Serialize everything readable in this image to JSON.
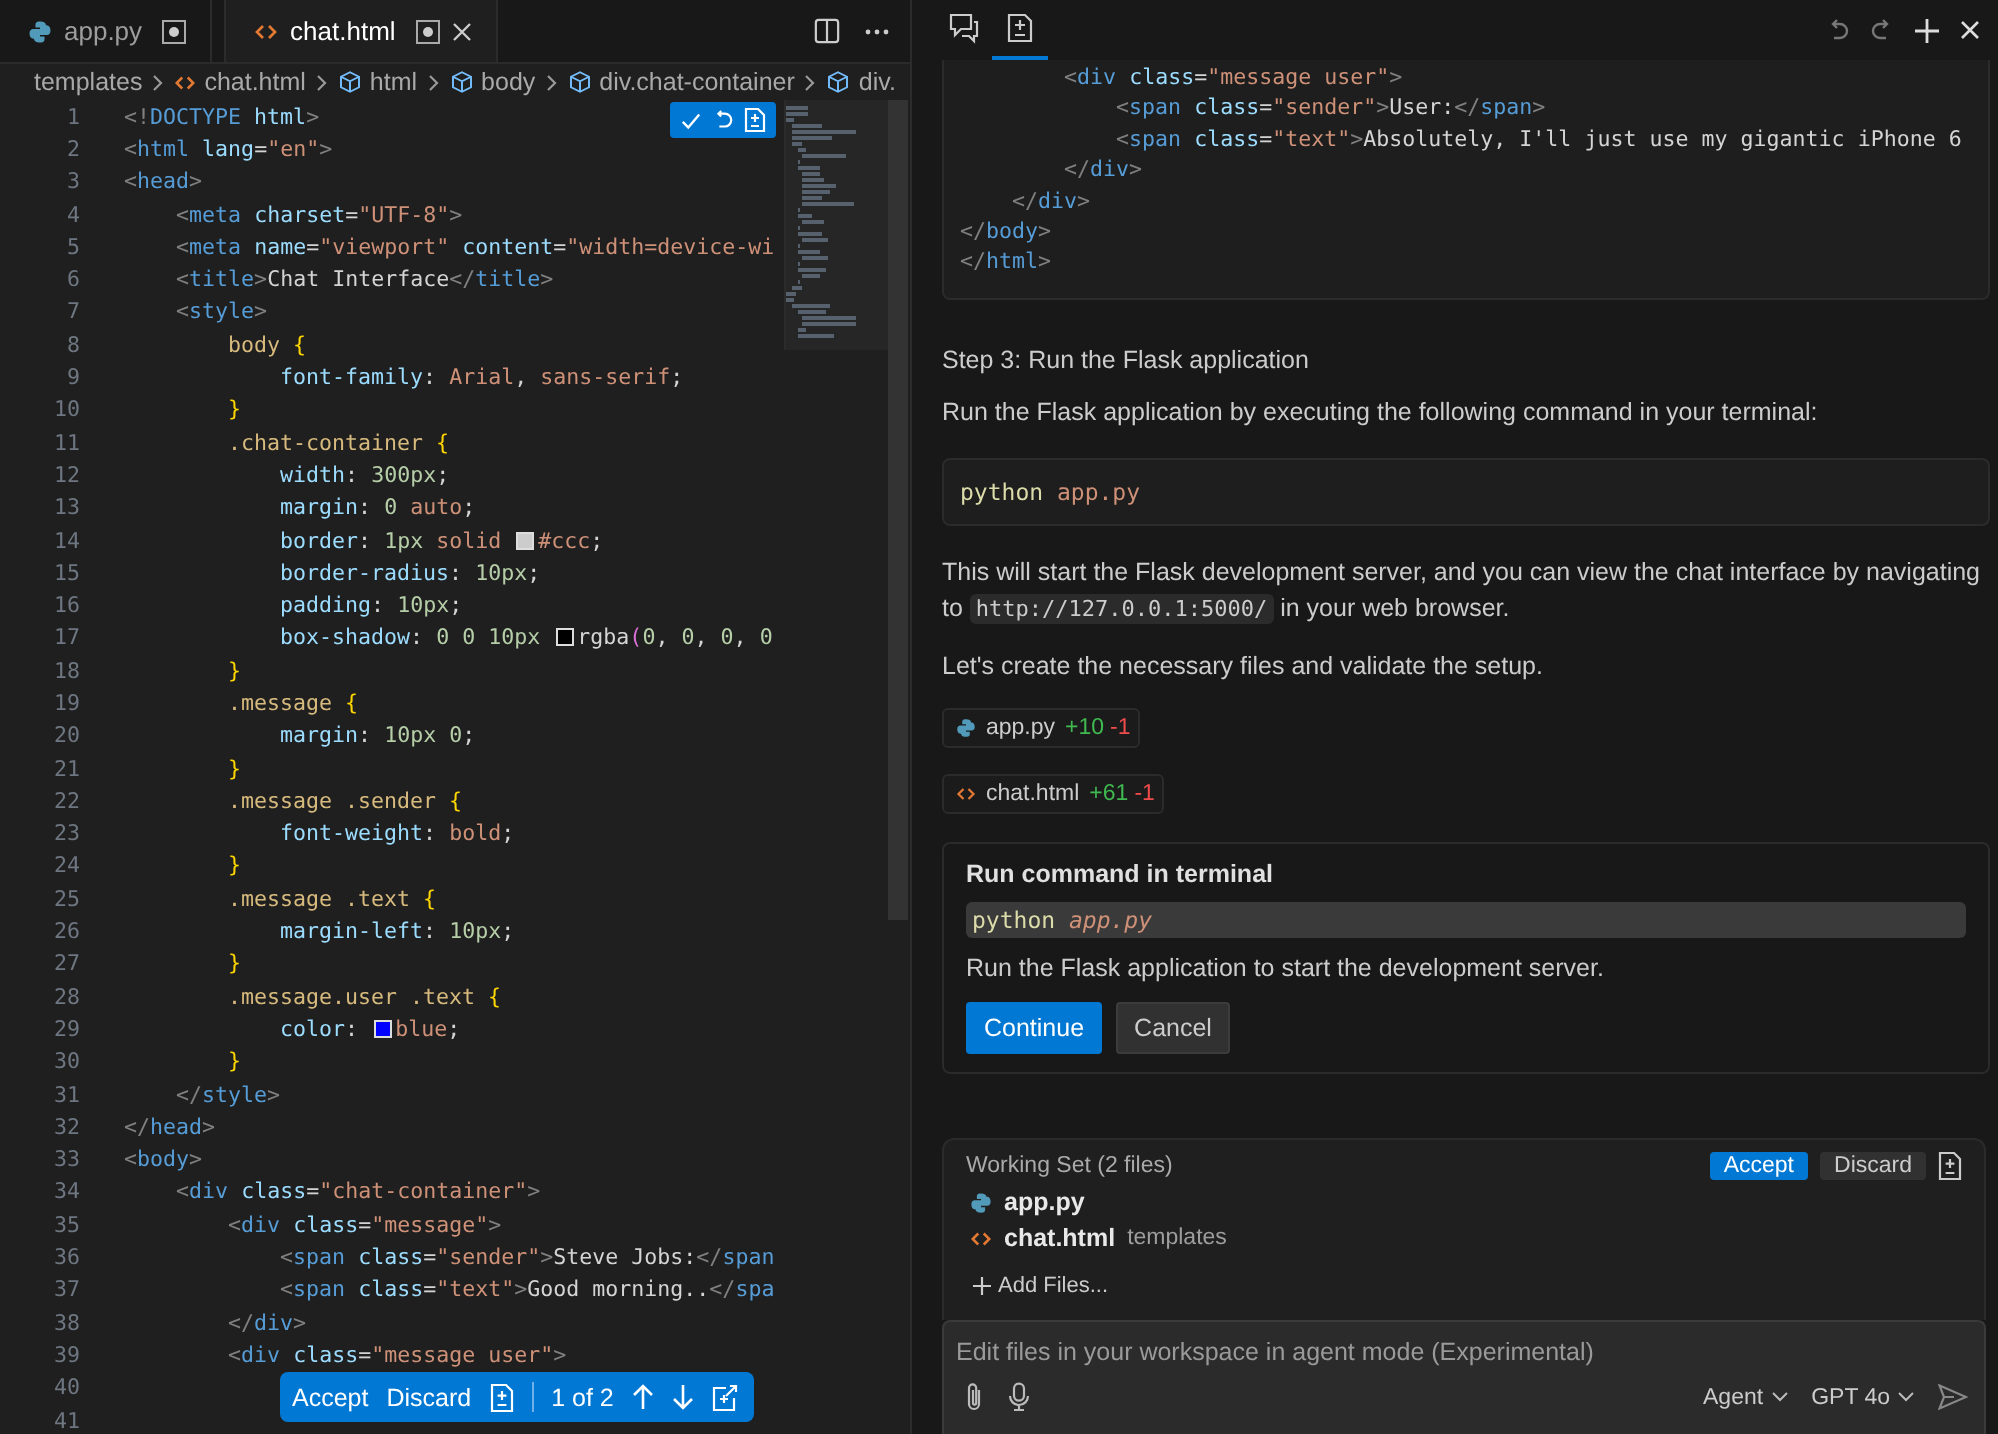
{
  "editor": {
    "tabs": [
      {
        "label": "app.py",
        "kind": "python",
        "selected": false,
        "dirty": true
      },
      {
        "label": "chat.html",
        "kind": "html",
        "selected": true,
        "dirty": true
      }
    ],
    "breadcrumbs": [
      {
        "label": "templates",
        "kind": "folder"
      },
      {
        "label": "chat.html",
        "kind": "html"
      },
      {
        "label": "html",
        "kind": "element"
      },
      {
        "label": "body",
        "kind": "element"
      },
      {
        "label": "div.chat-container",
        "kind": "element"
      },
      {
        "label": "div.",
        "kind": "element"
      }
    ],
    "lines": [
      {
        "number": "1",
        "kind": "html",
        "text": "<!DOCTYPE html>"
      },
      {
        "number": "2",
        "kind": "html",
        "text": "<html lang=\"en\">"
      },
      {
        "number": "3",
        "kind": "html",
        "text": "<head>"
      },
      {
        "number": "4",
        "kind": "html",
        "text": "    <meta charset=\"UTF-8\">"
      },
      {
        "number": "5",
        "kind": "html",
        "text": "    <meta name=\"viewport\" content=\"width=device-wi"
      },
      {
        "number": "6",
        "kind": "html",
        "text": "    <title>Chat Interface</title>"
      },
      {
        "number": "7",
        "kind": "html",
        "text": "    <style>"
      },
      {
        "number": "8",
        "kind": "css",
        "text": "        body {"
      },
      {
        "number": "9",
        "kind": "css",
        "text": "            font-family: Arial, sans-serif;"
      },
      {
        "number": "10",
        "kind": "css",
        "text": "        }"
      },
      {
        "number": "11",
        "kind": "css",
        "text": "        .chat-container {"
      },
      {
        "number": "12",
        "kind": "css",
        "text": "            width: 300px;"
      },
      {
        "number": "13",
        "kind": "css",
        "text": "            margin: 0 auto;"
      },
      {
        "number": "14",
        "kind": "css",
        "parts": [
          {
            "text": "            border: 1px solid "
          },
          {
            "kind": "swatch",
            "color": "#cccccc"
          },
          {
            "text": "#ccc;"
          }
        ]
      },
      {
        "number": "15",
        "kind": "css",
        "text": "            border-radius: 10px;"
      },
      {
        "number": "16",
        "kind": "css",
        "text": "            padding: 10px;"
      },
      {
        "number": "17",
        "kind": "css",
        "parts": [
          {
            "text": "            box-shadow: 0 0 10px "
          },
          {
            "kind": "swatch",
            "color": "#000000"
          },
          {
            "text": "rgba(0, 0, 0, 0"
          }
        ]
      },
      {
        "number": "18",
        "kind": "css",
        "text": "        }"
      },
      {
        "number": "19",
        "kind": "css",
        "text": "        .message {"
      },
      {
        "number": "20",
        "kind": "css",
        "text": "            margin: 10px 0;"
      },
      {
        "number": "21",
        "kind": "css",
        "text": "        }"
      },
      {
        "number": "22",
        "kind": "css",
        "text": "        .message .sender {"
      },
      {
        "number": "23",
        "kind": "css",
        "text": "            font-weight: bold;"
      },
      {
        "number": "24",
        "kind": "css",
        "text": "        }"
      },
      {
        "number": "25",
        "kind": "css",
        "text": "        .message .text {"
      },
      {
        "number": "26",
        "kind": "css",
        "text": "            margin-left: 10px;"
      },
      {
        "number": "27",
        "kind": "css",
        "text": "        }"
      },
      {
        "number": "28",
        "kind": "css",
        "text": "        .message.user .text {"
      },
      {
        "number": "29",
        "kind": "css",
        "parts": [
          {
            "text": "            color: "
          },
          {
            "kind": "swatch",
            "color": "#0000ff"
          },
          {
            "text": "blue;"
          }
        ]
      },
      {
        "number": "30",
        "kind": "css",
        "text": "        }"
      },
      {
        "number": "31",
        "kind": "html",
        "text": "    </style>"
      },
      {
        "number": "32",
        "kind": "html",
        "text": "</head>"
      },
      {
        "number": "33",
        "kind": "html",
        "text": "<body>"
      },
      {
        "number": "34",
        "kind": "html",
        "text": "    <div class=\"chat-container\">"
      },
      {
        "number": "35",
        "kind": "html",
        "text": "        <div class=\"message\">"
      },
      {
        "number": "36",
        "kind": "html",
        "text": "            <span class=\"sender\">Steve Jobs:</span"
      },
      {
        "number": "37",
        "kind": "html",
        "text": "            <span class=\"text\">Good morning..</spa"
      },
      {
        "number": "38",
        "kind": "html",
        "text": "        </div>"
      },
      {
        "number": "39",
        "kind": "html",
        "text": "        <div class=\"message user\">"
      },
      {
        "number": "40"
      },
      {
        "number": "41"
      }
    ],
    "review_bar": {
      "accept": "Accept",
      "discard": "Discard",
      "position": "1 of 2"
    }
  },
  "chat": {
    "tabs": [
      {
        "kind": "chat",
        "selected": false
      },
      {
        "kind": "edits",
        "selected": true
      }
    ],
    "blocks": [
      {
        "kind": "code_block",
        "lines": [
          {
            "text": "        <div class=\"message user\">"
          },
          {
            "text": "            <span class=\"sender\">User:</span>"
          },
          {
            "text": "            <span class=\"text\">Absolutely, I'll just use my gigantic iPhone 6"
          },
          {
            "text": "        </div>"
          },
          {
            "text": "    </div>"
          },
          {
            "text": "</body>"
          },
          {
            "text": "</html>"
          }
        ]
      },
      {
        "kind": "heading",
        "text": "Step 3: Run the Flask application"
      },
      {
        "kind": "paragraph",
        "text": "Run the Flask application by executing the following command in your terminal:"
      },
      {
        "kind": "command",
        "program": "python",
        "args": "app.py"
      },
      {
        "kind": "rich_paragraph",
        "parts": [
          {
            "kind": "text",
            "text": "This will start the Flask development server, and you can view the chat interface by navigating to "
          },
          {
            "kind": "code",
            "text": "http://127.0.0.1:5000/"
          },
          {
            "kind": "text",
            "text": " in your web browser."
          }
        ]
      },
      {
        "kind": "paragraph",
        "text": "Let's create the necessary files and validate the setup."
      },
      {
        "kind": "file_change",
        "file": {
          "name": "app.py",
          "kind": "python"
        },
        "added": "+10",
        "removed": "-1"
      },
      {
        "kind": "file_change",
        "file": {
          "name": "chat.html",
          "kind": "html"
        },
        "added": "+61",
        "removed": "-1"
      },
      {
        "kind": "terminal_card",
        "title": "Run command in terminal",
        "program": "python",
        "args": "app.py",
        "description": "Run the Flask application to start the development server.",
        "buttons": [
          {
            "label": "Continue",
            "kind": "primary"
          },
          {
            "label": "Cancel",
            "kind": "secondary"
          }
        ]
      }
    ],
    "working_set": {
      "title": "Working Set (2 files)",
      "buttons": [
        {
          "label": "Accept",
          "kind": "primary"
        },
        {
          "label": "Discard",
          "kind": "secondary"
        }
      ],
      "files": [
        {
          "name": "app.py",
          "kind": "python"
        },
        {
          "name": "chat.html",
          "kind": "html",
          "folder": "templates"
        }
      ],
      "add_label": "Add Files..."
    },
    "input": {
      "placeholder": "Edit files in your workspace in agent mode (Experimental)",
      "mode": "Agent",
      "model": "GPT 4o"
    }
  }
}
